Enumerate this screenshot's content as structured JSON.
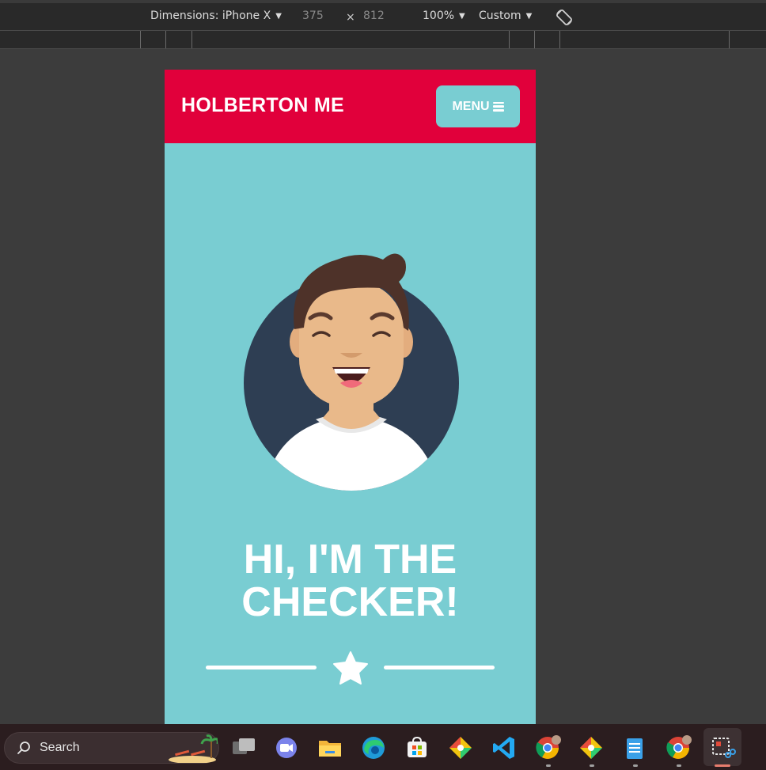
{
  "devtools": {
    "dimensions_label": "Dimensions: iPhone X",
    "width_value": "375",
    "times_symbol": "×",
    "height_value": "812",
    "zoom_label": "100%",
    "throttle_label": "Custom",
    "caret": "▼"
  },
  "site": {
    "brand": "HOLBERTON ME",
    "menu_label": "MENU",
    "hero_line1": "HI, I'M THE",
    "hero_line2": "CHECKER!",
    "colors": {
      "header": "#e1003b",
      "accent": "#79cdd2",
      "avatar_bg": "#2e3e53"
    }
  },
  "taskbar": {
    "search_label": "Search",
    "icons": [
      "task-view-icon",
      "teams-chat-icon",
      "file-explorer-icon",
      "edge-icon",
      "microsoft-store-icon",
      "git-icon",
      "vscode-icon",
      "chrome-icon",
      "git-icon",
      "notepad-icon",
      "chrome-icon",
      "snipping-tool-icon"
    ]
  }
}
